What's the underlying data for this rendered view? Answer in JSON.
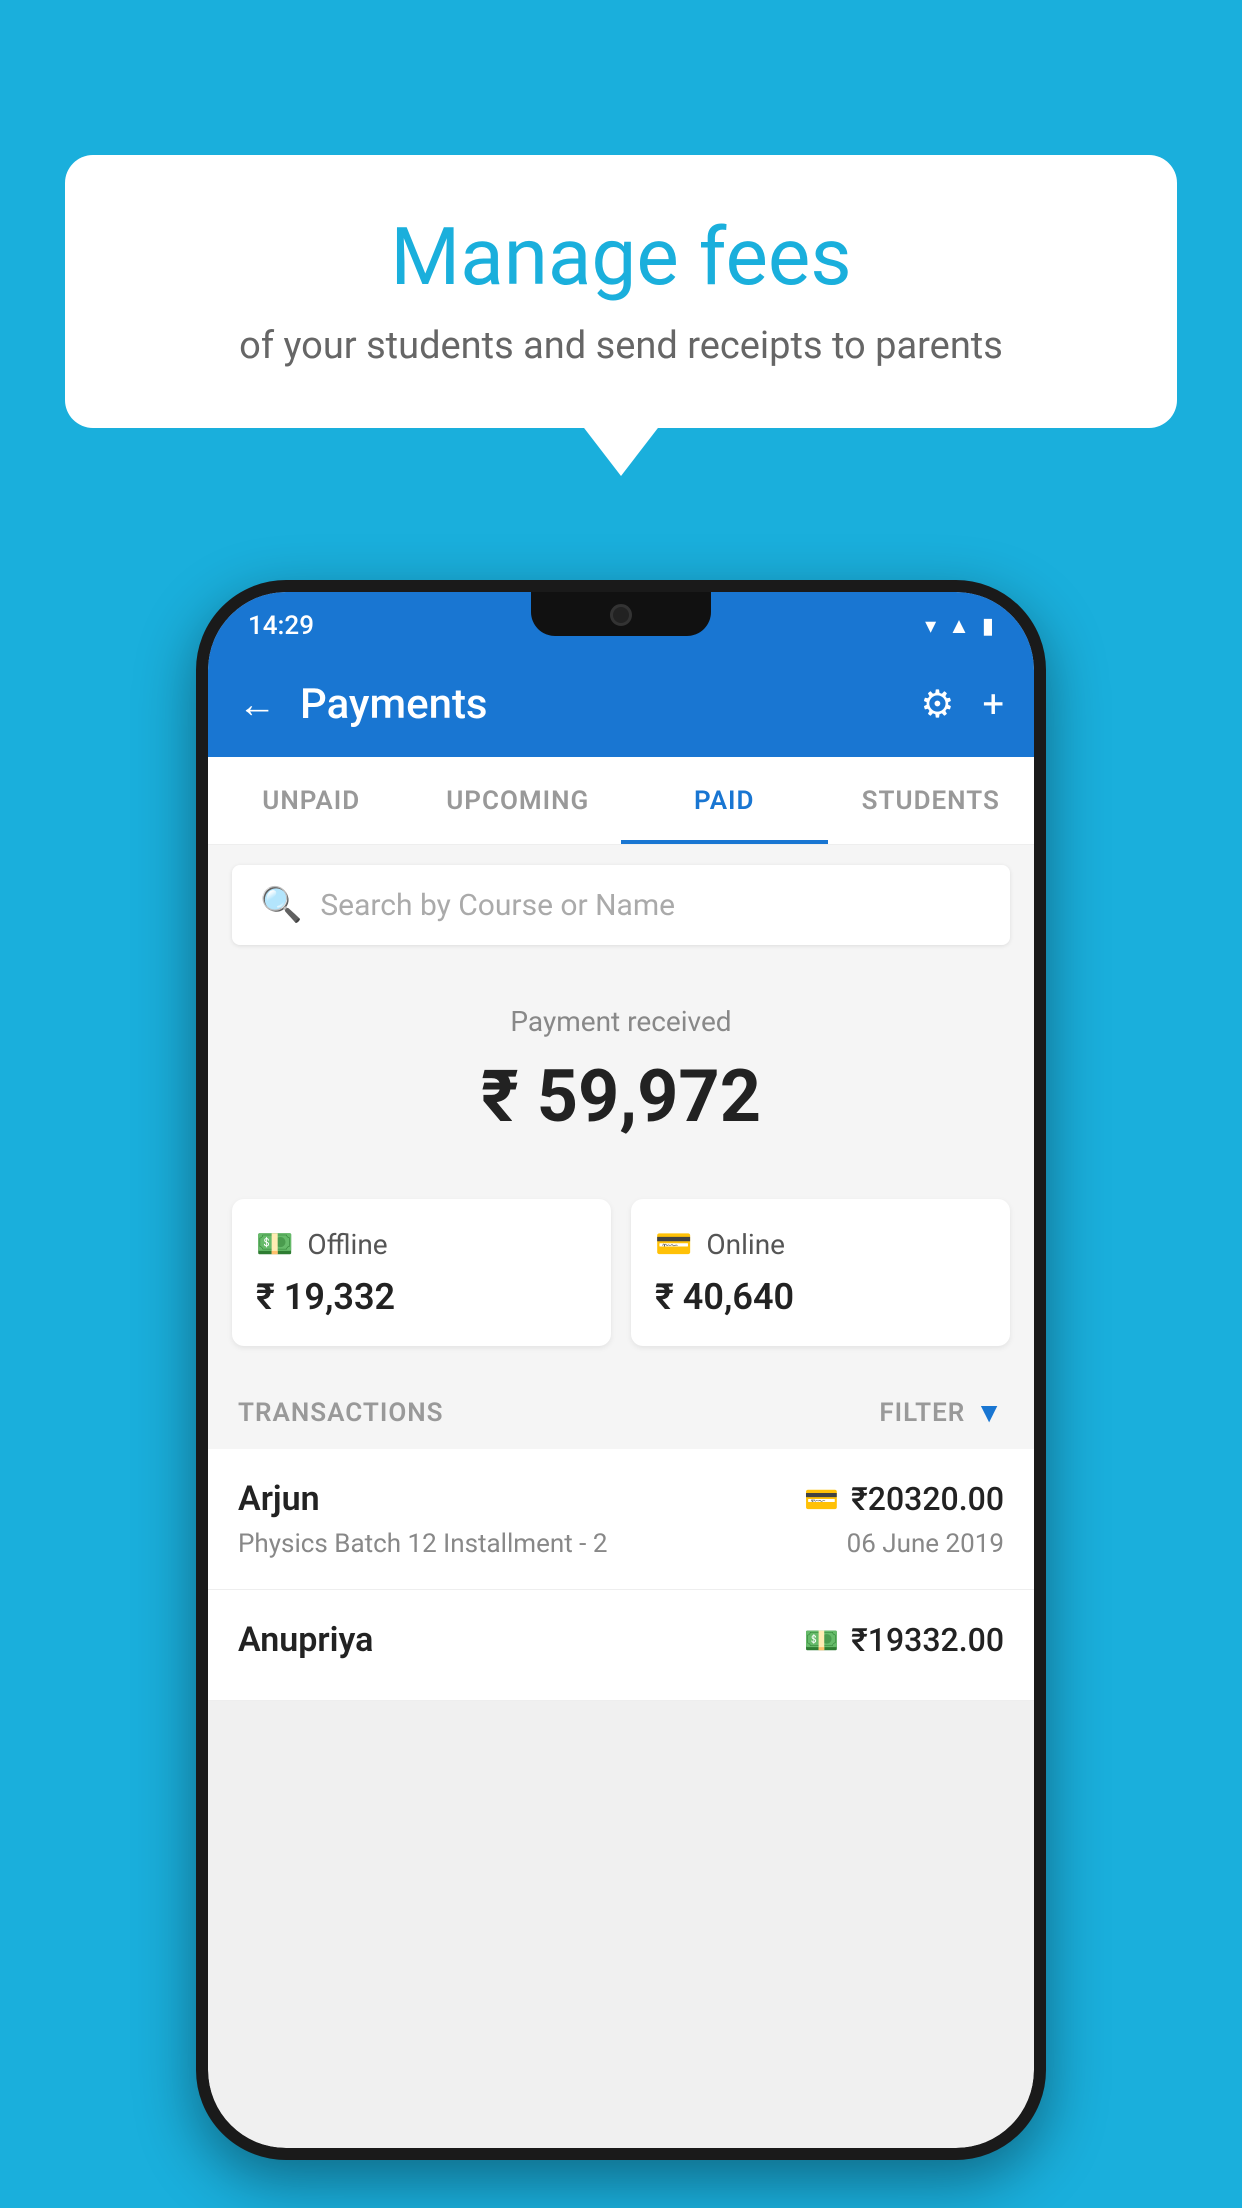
{
  "background_color": "#1AAFDC",
  "speech_bubble": {
    "title": "Manage fees",
    "subtitle": "of your students and send receipts to parents"
  },
  "phone": {
    "status_bar": {
      "time": "14:29",
      "icons": [
        "wifi",
        "signal",
        "battery"
      ]
    },
    "app_bar": {
      "title": "Payments",
      "back_label": "←",
      "settings_label": "⚙",
      "add_label": "+"
    },
    "tabs": [
      {
        "label": "UNPAID",
        "active": false
      },
      {
        "label": "UPCOMING",
        "active": false
      },
      {
        "label": "PAID",
        "active": true
      },
      {
        "label": "STUDENTS",
        "active": false
      }
    ],
    "search": {
      "placeholder": "Search by Course or Name"
    },
    "payment_section": {
      "received_label": "Payment received",
      "total_amount": "₹ 59,972",
      "offline": {
        "label": "Offline",
        "amount": "₹ 19,332"
      },
      "online": {
        "label": "Online",
        "amount": "₹ 40,640"
      }
    },
    "transactions": {
      "section_label": "TRANSACTIONS",
      "filter_label": "FILTER",
      "items": [
        {
          "name": "Arjun",
          "course": "Physics Batch 12 Installment - 2",
          "amount": "₹20320.00",
          "date": "06 June 2019",
          "method": "card"
        },
        {
          "name": "Anupriya",
          "course": "",
          "amount": "₹19332.00",
          "date": "",
          "method": "cash"
        }
      ]
    }
  }
}
